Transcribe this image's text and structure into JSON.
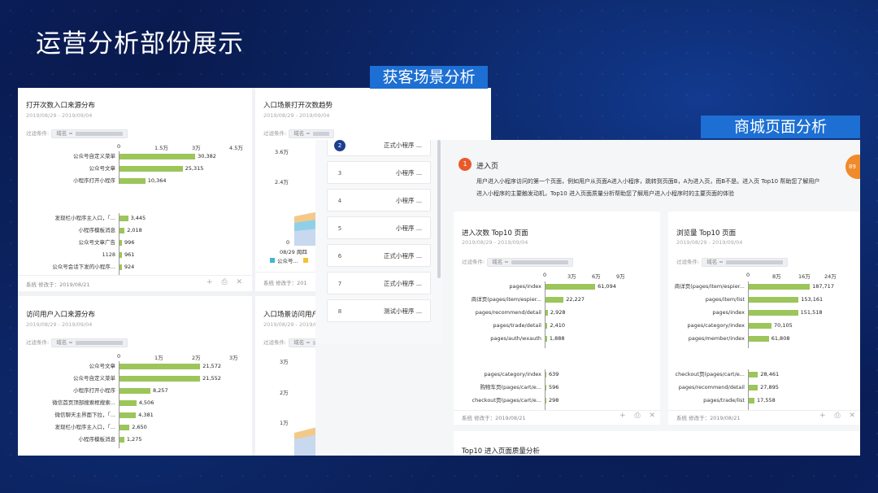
{
  "slide": {
    "title": "运营分析部份展示",
    "tag_acquire": "获客场景分析",
    "tag_mall": "商城页面分析"
  },
  "common": {
    "date": "2019/08/29 - 2019/09/04",
    "filter_label": "过滤条件:",
    "filter_key": "域名 =",
    "footer": "系统 修改于：2019/08/21",
    "footer_short": "系统 修改于：201",
    "icons": "+ ⎙ ✕"
  },
  "left": {
    "c1": {
      "title": "打开次数入口来源分布",
      "ticks": [
        "0",
        "1.5万",
        "3万",
        "4.5万"
      ],
      "max": 45000,
      "rows": [
        {
          "label": "公众号自定义菜单",
          "value": 30382,
          "text": "30,382"
        },
        {
          "label": "公众号文章",
          "value": 25315,
          "text": "25,315"
        },
        {
          "label": "小程序打开小程序",
          "value": 10364,
          "text": "10,364"
        }
      ],
      "rows2": [
        {
          "label": "发现栏小程序主入口，「...",
          "value": 3445,
          "text": "3,445"
        },
        {
          "label": "小程序模板消息",
          "value": 2018,
          "text": "2,018"
        },
        {
          "label": "公众号文章广告",
          "value": 996,
          "text": "996"
        },
        {
          "label": "1128",
          "value": 961,
          "text": "961"
        },
        {
          "label": "公众号会话下发的小程序...",
          "value": 924,
          "text": "924"
        }
      ]
    },
    "c2": {
      "title": "入口场景打开次数趋势",
      "y1": "3.6万",
      "y2": "2.4万",
      "y0": "0",
      "xlabel": "08/29 周四",
      "legend": "公众号..."
    },
    "c3": {
      "title": "访问用户入口来源分布",
      "ticks": [
        "0",
        "1万",
        "2万",
        "3万"
      ],
      "max": 30000,
      "rows": [
        {
          "label": "公众号文章",
          "value": 21572,
          "text": "21,572"
        },
        {
          "label": "公众号自定义菜单",
          "value": 21552,
          "text": "21,552"
        },
        {
          "label": "小程序打开小程序",
          "value": 8257,
          "text": "8,257"
        },
        {
          "label": "微信首页顶部搜索框搜索...",
          "value": 4506,
          "text": "4,506"
        },
        {
          "label": "微信聊天主界面下拉，「...",
          "value": 4381,
          "text": "4,381"
        },
        {
          "label": "发现栏小程序主入口，「...",
          "value": 2650,
          "text": "2,650"
        },
        {
          "label": "小程序模板消息",
          "value": 1275,
          "text": "1,275"
        }
      ]
    },
    "c4": {
      "title": "入口场景访问用户",
      "y1": "3万",
      "y2": "2万",
      "y3": "1万"
    }
  },
  "right": {
    "list": [
      {
        "n": "2",
        "t": "正式小程序 ..."
      },
      {
        "n": "3",
        "t": "小程序 ..."
      },
      {
        "n": "4",
        "t": "小程序 ..."
      },
      {
        "n": "5",
        "t": "小程序 ..."
      },
      {
        "n": "6",
        "t": "正式小程序 ..."
      },
      {
        "n": "7",
        "t": "正式小程序 ..."
      },
      {
        "n": "8",
        "t": "测试小程序 ..."
      }
    ],
    "section": {
      "num": "1",
      "title": "进入页",
      "desc1": "用户进入小程序访问的第一个页面，例如用户从页面A进入小程序，跳转到页面B，A为进入页，而B不是。进入页 Top10 帮助您了解用户",
      "desc2": "进入小程序的主要触发动机，Top10 进入页面质量分析帮助您了解用户进入小程序时的主要页面的体验",
      "pct": "89"
    },
    "m1": {
      "title": "进入次数 Top10 页面",
      "ticks": [
        "0",
        "3万",
        "6万",
        "9万"
      ],
      "max": 90000,
      "rows": [
        {
          "label": "pages/index",
          "value": 61094,
          "text": "61,094"
        },
        {
          "label": "商详页(pages/item/espier...",
          "value": 22227,
          "text": "22,227"
        },
        {
          "label": "pages/recommend/detail",
          "value": 2928,
          "text": "2,928"
        },
        {
          "label": "pages/trade/detail",
          "value": 2410,
          "text": "2,410"
        },
        {
          "label": "pages/auth/wxauth",
          "value": 1888,
          "text": "1,888"
        }
      ],
      "rows2": [
        {
          "label": "pages/category/index",
          "value": 639,
          "text": "639"
        },
        {
          "label": "购物车页(pages/cart/e...",
          "value": 596,
          "text": "596"
        },
        {
          "label": "checkout页(pages/cart/e...",
          "value": 298,
          "text": "298"
        }
      ]
    },
    "m2": {
      "title": "浏览量 Top10 页面",
      "ticks": [
        "0",
        "8万",
        "16万",
        "24万"
      ],
      "max": 240000,
      "rows": [
        {
          "label": "商详页(pages/item/espier...",
          "value": 187717,
          "text": "187,717"
        },
        {
          "label": "pages/item/list",
          "value": 153161,
          "text": "153,161"
        },
        {
          "label": "pages/index",
          "value": 151518,
          "text": "151,518"
        },
        {
          "label": "pages/category/index",
          "value": 70105,
          "text": "70,105"
        },
        {
          "label": "pages/member/index",
          "value": 61808,
          "text": "61,808"
        }
      ],
      "rows2": [
        {
          "label": "checkout页(pages/cart/e...",
          "value": 28461,
          "text": "28,461"
        },
        {
          "label": "pages/recommend/detail",
          "value": 27895,
          "text": "27,895"
        },
        {
          "label": "pages/trade/list",
          "value": 17558,
          "text": "17,558"
        }
      ]
    },
    "bottom_title": "Top10 进入页面质量分析"
  }
}
